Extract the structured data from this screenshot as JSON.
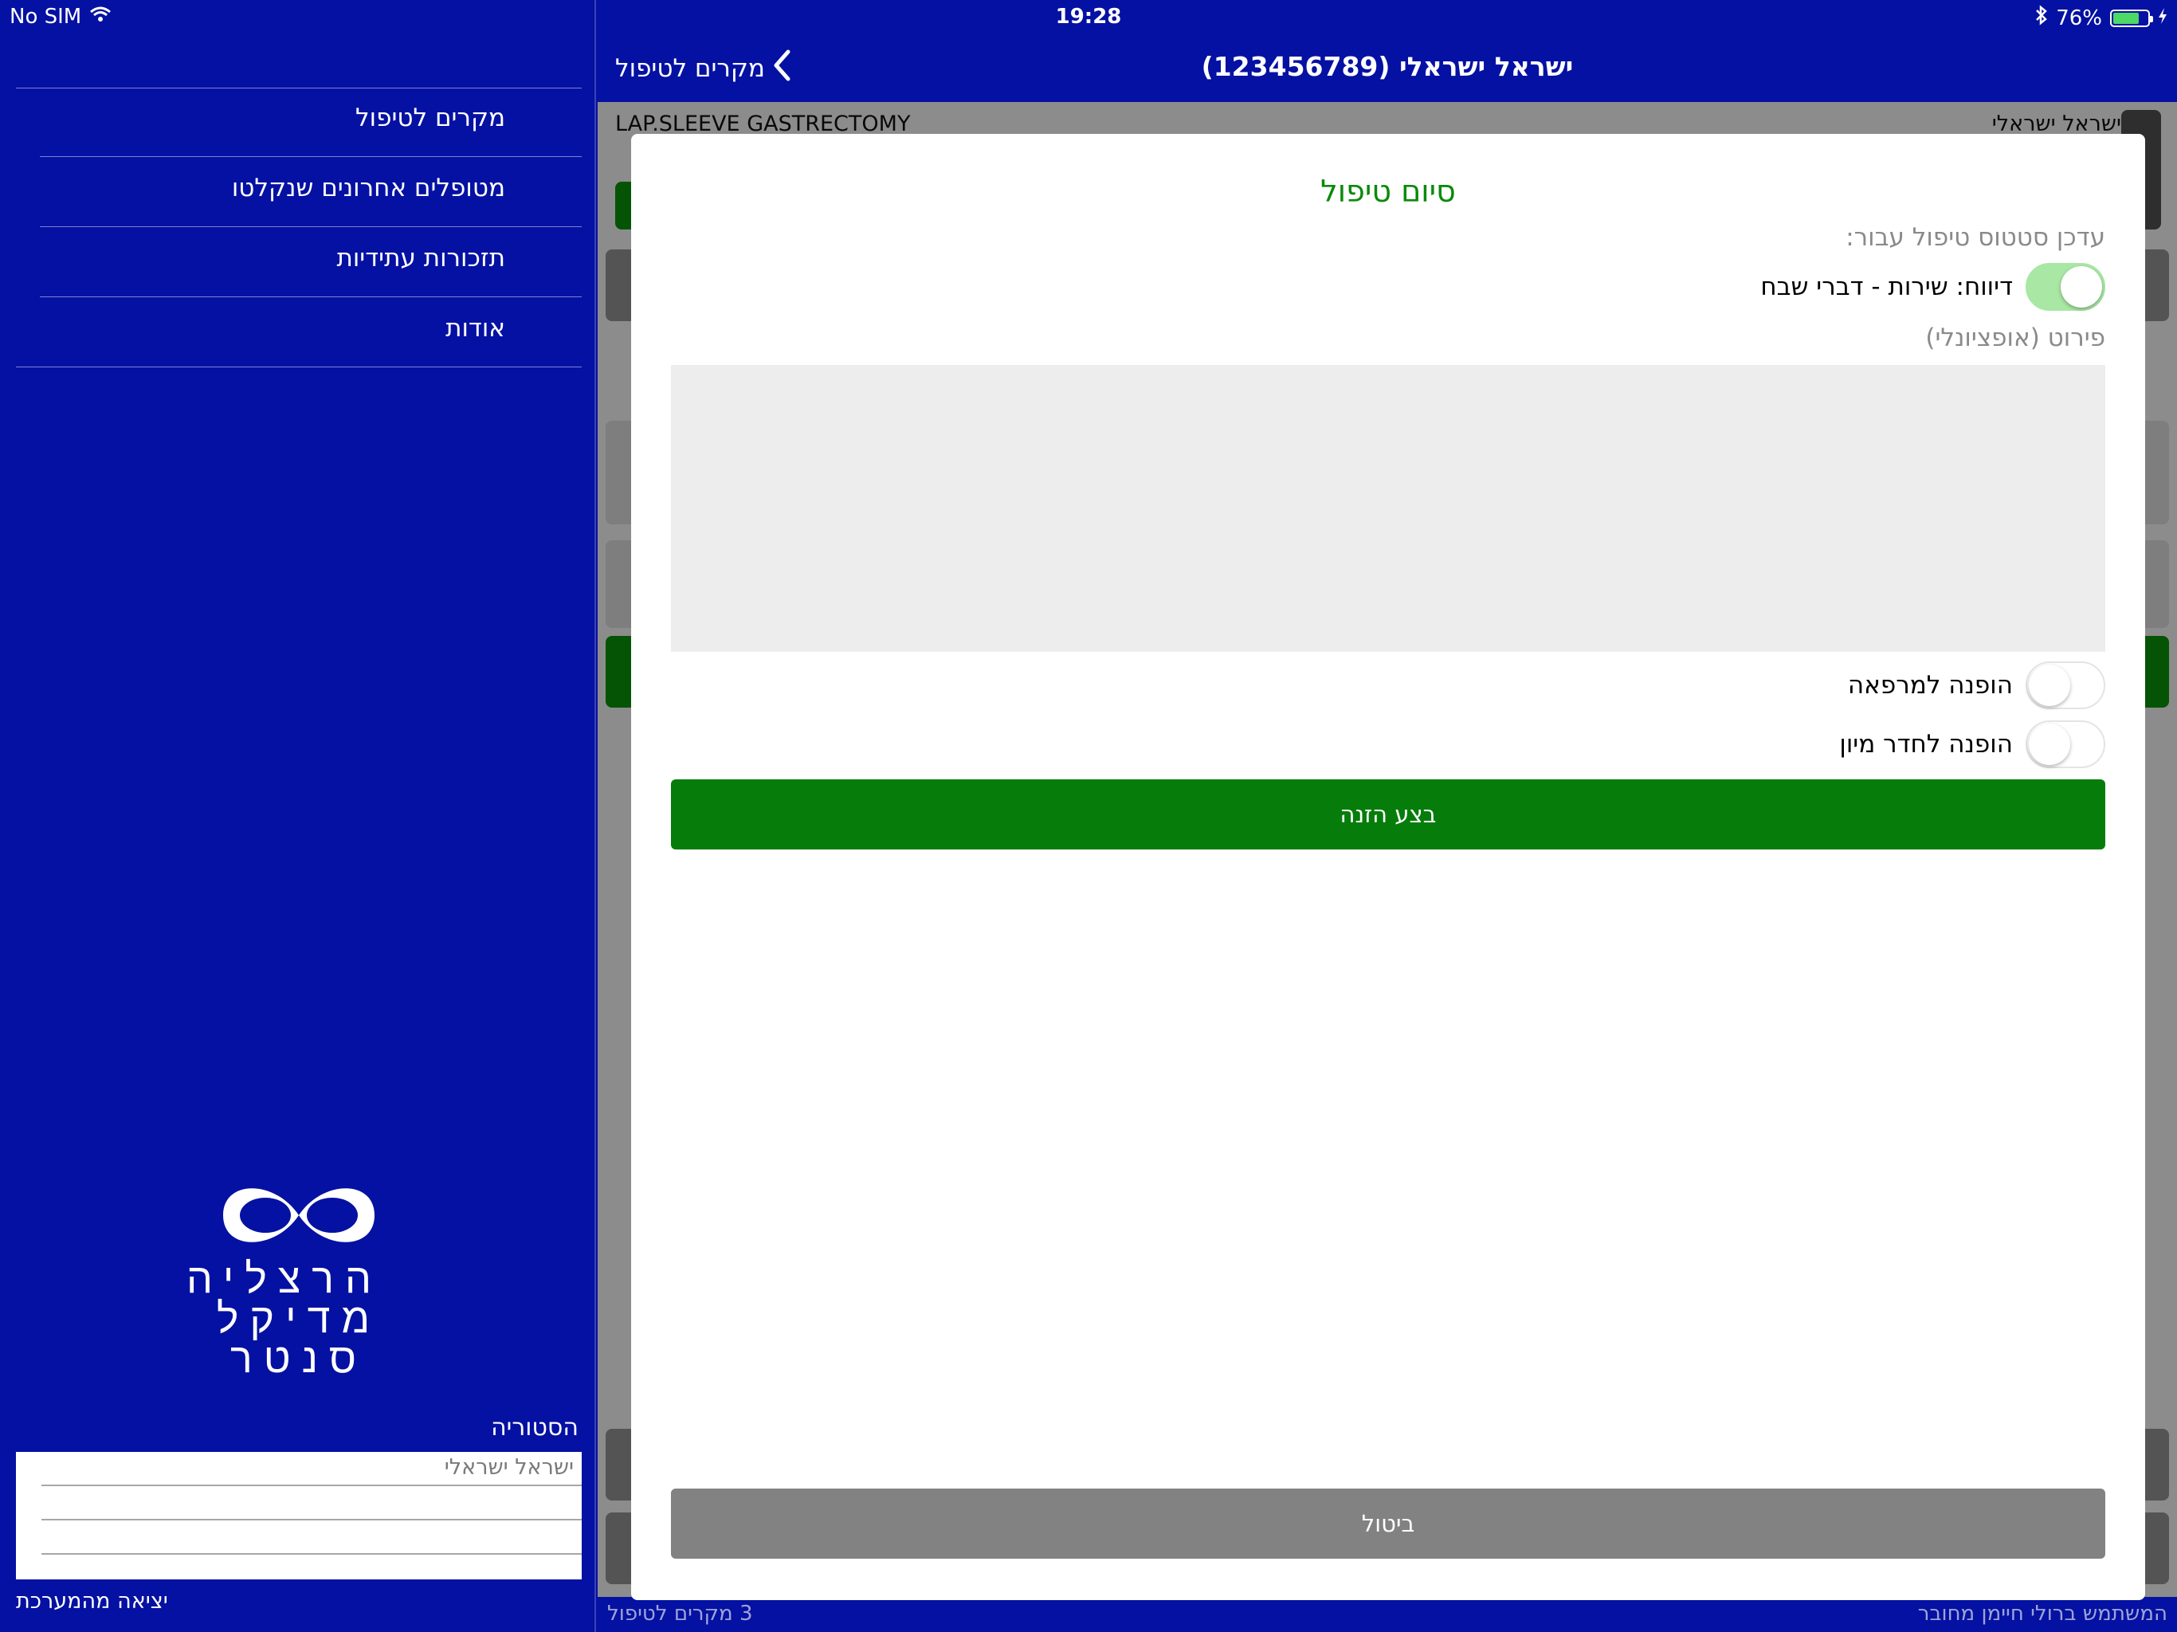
{
  "status_bar": {
    "carrier": "No SIM",
    "time": "19:28",
    "battery": "76%",
    "battery_level": 0.76
  },
  "sidebar": {
    "items": [
      {
        "label": "מקרים לטיפול"
      },
      {
        "label": "מטופלים אחרונים שנקלטו"
      },
      {
        "label": "תזכורות עתידיות"
      },
      {
        "label": "אודות"
      }
    ],
    "logo_lines": [
      "הרצליה",
      "מדיקל",
      "סנטר"
    ],
    "history_title": "הסטוריה",
    "history_entries": [
      "ישראל ישראלי"
    ],
    "logout_label": "יציאה מהמערכת"
  },
  "navbar": {
    "back_label": "מקרים לטיפול",
    "title": "ישראל ישראלי (123456789)"
  },
  "background": {
    "procedure": "LAP.SLEEVE GASTRECTOMY",
    "patient_name": "ישראל ישראלי",
    "footer_left": "3 מקרים לטיפול",
    "footer_right": "המשתמש ברולי חיימן מחובר"
  },
  "modal": {
    "title": "סיום טיפול",
    "update_label": "עדכן סטטוס טיפול עבור:",
    "toggles": [
      {
        "label": "דיווח: שירות - דברי שבח",
        "on": true
      },
      {
        "label": "הופנה למרפאה",
        "on": false
      },
      {
        "label": "הופנה לחדר מיון",
        "on": false
      }
    ],
    "details_label": "פירוט (אופציונלי)",
    "details_value": "",
    "submit_label": "בצע הזנה",
    "cancel_label": "ביטול"
  },
  "colors": {
    "primary_blue": "#0511a2",
    "modal_title_green": "#0a8a0a",
    "submit_green": "#067d0b",
    "cancel_gray": "#828282",
    "toggle_on": "#a8e7a4",
    "details_bg": "#ededed"
  }
}
